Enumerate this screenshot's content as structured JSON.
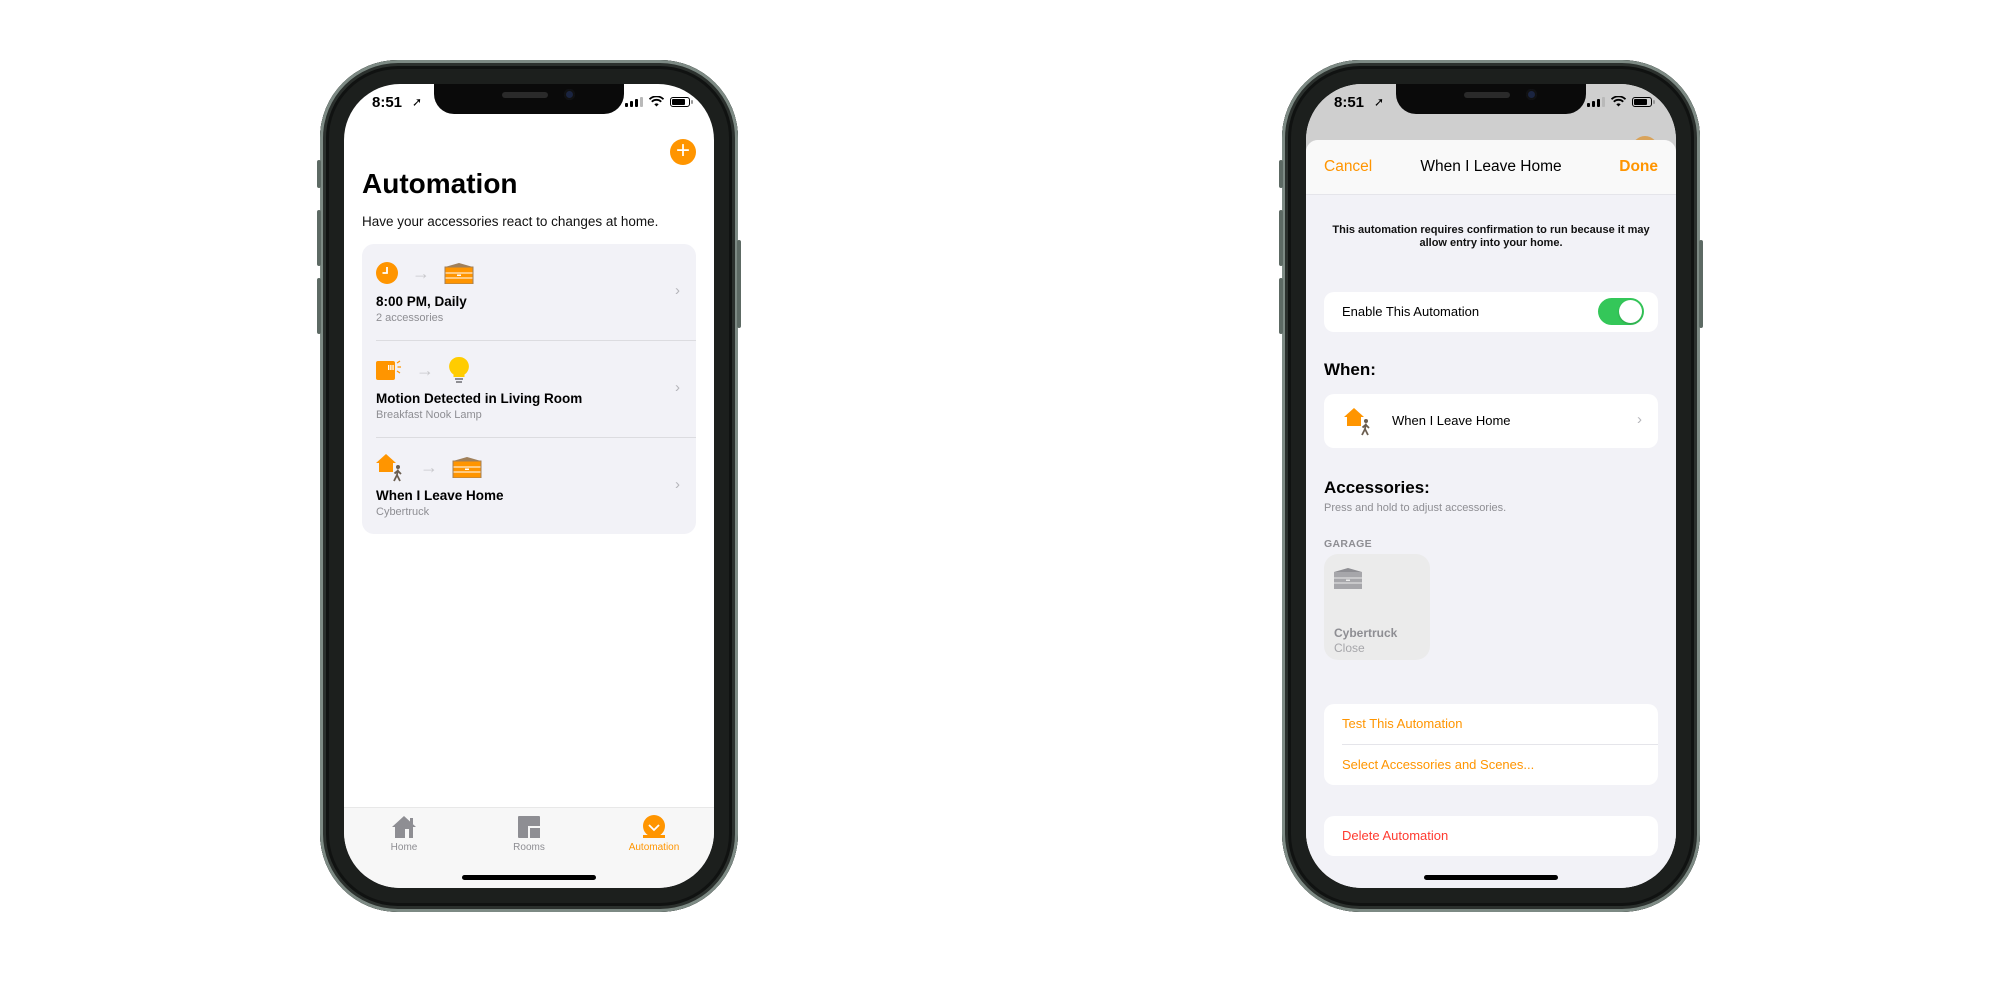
{
  "left_phone": {
    "status": {
      "time": "8:51"
    },
    "add_button_label": "+",
    "title": "Automation",
    "subtitle": "Have your accessories react to changes at home.",
    "automations": [
      {
        "title": "8:00 PM, Daily",
        "subtitle": "2 accessories",
        "trigger_icon": "clock-icon",
        "target_icon": "garage-door-icon"
      },
      {
        "title": "Motion Detected in Living Room",
        "subtitle": "Breakfast Nook Lamp",
        "trigger_icon": "motion-sensor-icon",
        "target_icon": "lightbulb-icon"
      },
      {
        "title": "When I Leave Home",
        "subtitle": "Cybertruck",
        "trigger_icon": "leave-home-icon",
        "target_icon": "garage-door-icon"
      }
    ],
    "tabs": [
      {
        "label": "Home",
        "icon": "house-icon",
        "active": false
      },
      {
        "label": "Rooms",
        "icon": "rooms-icon",
        "active": false
      },
      {
        "label": "Automation",
        "icon": "automation-icon",
        "active": true
      }
    ]
  },
  "right_phone": {
    "status": {
      "time": "8:51"
    },
    "nav": {
      "cancel": "Cancel",
      "title": "When I Leave Home",
      "done": "Done"
    },
    "notice": "This automation requires confirmation to run because it may allow entry into your home.",
    "enable_label": "Enable This Automation",
    "enabled": true,
    "when_header": "When:",
    "when_item": "When I Leave Home",
    "accessories_header": "Accessories:",
    "accessories_hint": "Press and hold to adjust accessories.",
    "room_label": "GARAGE",
    "accessory": {
      "name": "Cybertruck",
      "state": "Close"
    },
    "actions": [
      "Test This Automation",
      "Select Accessories and Scenes..."
    ],
    "delete_label": "Delete Automation"
  },
  "colors": {
    "accent": "#ff9500",
    "toggle_on": "#34c759",
    "destructive": "#ff3b30",
    "secondary_text": "#8e8e93"
  }
}
